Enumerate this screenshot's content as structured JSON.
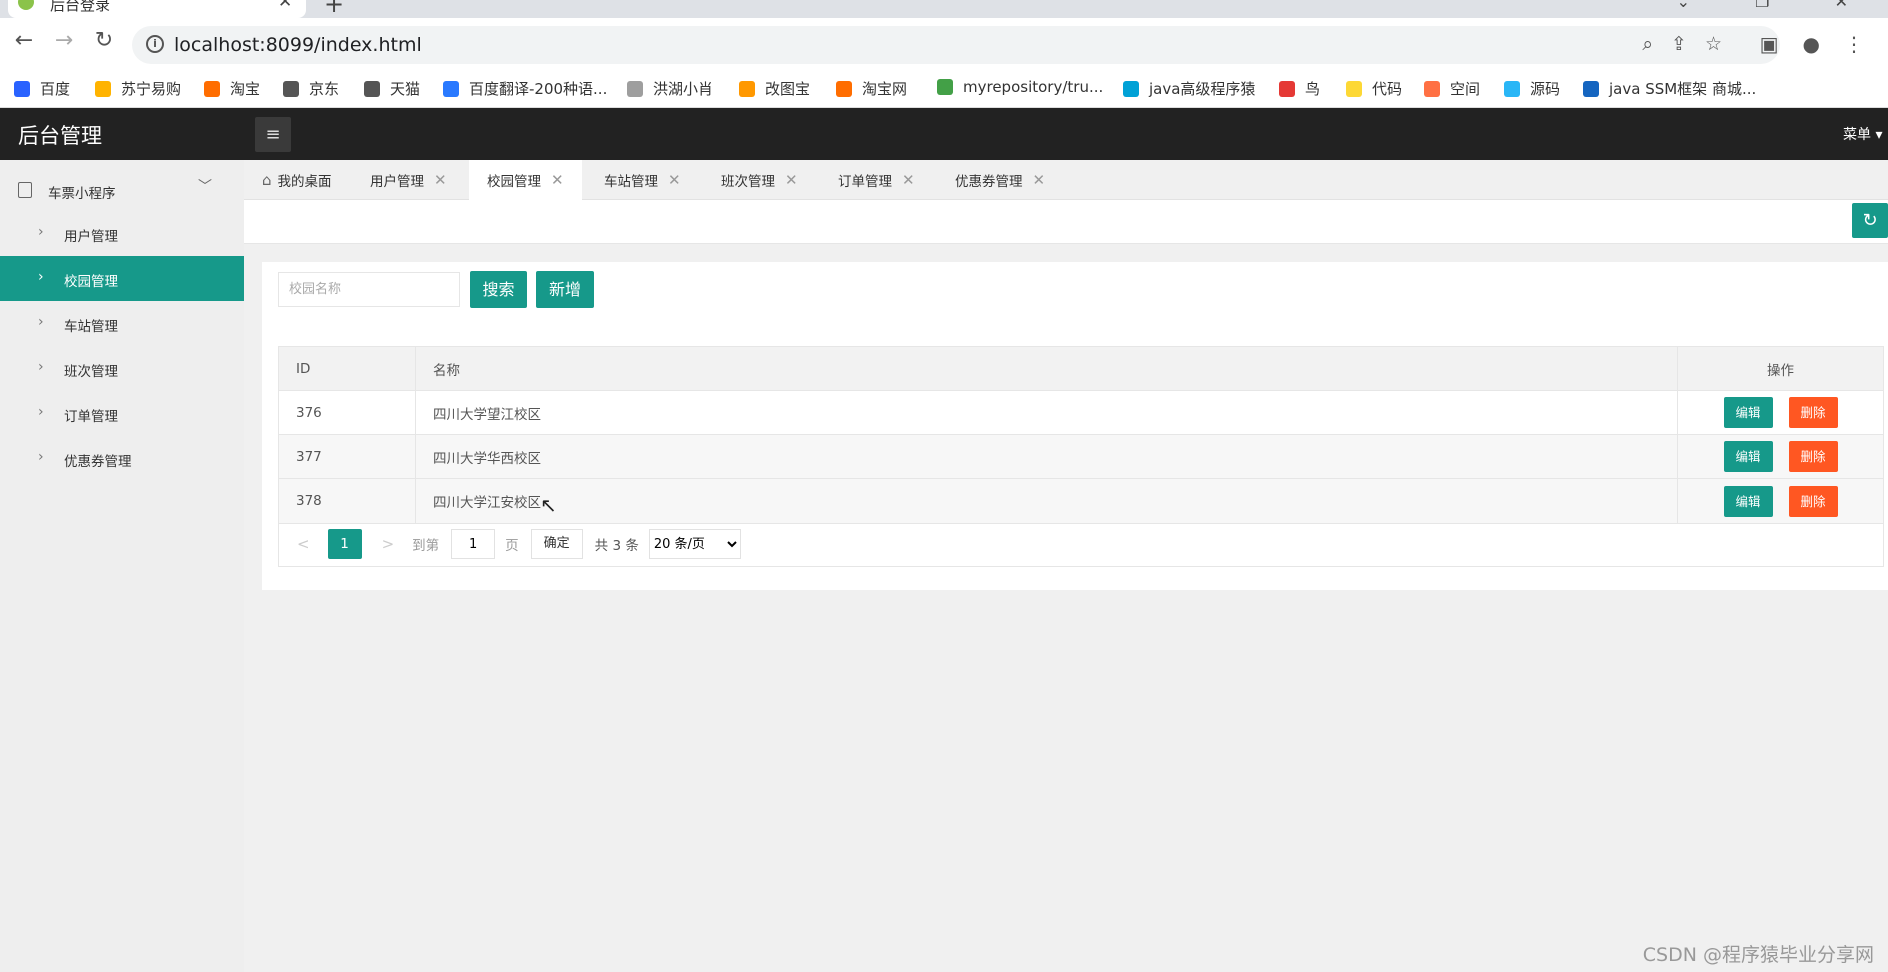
{
  "browser": {
    "tab_title": "后台登录",
    "tab_close": "✕",
    "new_tab": "+",
    "url": "localhost:8099/index.html",
    "bookmarks": [
      {
        "label": "百度",
        "color": "#2962ff"
      },
      {
        "label": "苏宁易购",
        "color": "#ffb300"
      },
      {
        "label": "淘宝",
        "color": "#ff6d00"
      },
      {
        "label": "京东",
        "color": "#555555"
      },
      {
        "label": "天猫",
        "color": "#555555"
      },
      {
        "label": "百度翻译-200种语...",
        "color": "#2979ff"
      },
      {
        "label": "洪湖小肖",
        "color": "#9e9e9e"
      },
      {
        "label": "改图宝",
        "color": "#ff9800"
      },
      {
        "label": "淘宝网",
        "color": "#ff6d00"
      },
      {
        "label": "myrepository/tru...",
        "color": "#43a047"
      },
      {
        "label": "java高级程序猿",
        "color": "#00a1d6"
      },
      {
        "label": "鸟",
        "color": "#e53935"
      },
      {
        "label": "代码",
        "color": "#fdd835"
      },
      {
        "label": "空间",
        "color": "#ff7043"
      },
      {
        "label": "源码",
        "color": "#29b6f6"
      },
      {
        "label": "java SSM框架 商城...",
        "color": "#1565c0"
      }
    ]
  },
  "header": {
    "app_title": "后台管理",
    "menu_label": "菜单 ▾",
    "menu_toggle": "≡"
  },
  "sidebar": {
    "group_label": "车票小程序",
    "group_chev": "﹀",
    "items": [
      {
        "label": "用户管理"
      },
      {
        "label": "校园管理"
      },
      {
        "label": "车站管理"
      },
      {
        "label": "班次管理"
      },
      {
        "label": "订单管理"
      },
      {
        "label": "优惠券管理"
      }
    ]
  },
  "tabs": [
    {
      "label": "我的桌面"
    },
    {
      "label": "用户管理",
      "close": "✕"
    },
    {
      "label": "校园管理",
      "close": "✕"
    },
    {
      "label": "车站管理",
      "close": "✕"
    },
    {
      "label": "班次管理",
      "close": "✕"
    },
    {
      "label": "订单管理",
      "close": "✕"
    },
    {
      "label": "优惠券管理",
      "close": "✕"
    }
  ],
  "search": {
    "placeholder": "校园名称",
    "search_label": "搜索",
    "add_label": "新增"
  },
  "table": {
    "headers": {
      "id": "ID",
      "name": "名称",
      "ops": "操作"
    },
    "rows": [
      {
        "id": "376",
        "name": "四川大学望江校区"
      },
      {
        "id": "377",
        "name": "四川大学华西校区"
      },
      {
        "id": "378",
        "name": "四川大学江安校区"
      }
    ],
    "edit_label": "编辑",
    "delete_label": "删除"
  },
  "pager": {
    "prev": "<",
    "current": "1",
    "next": ">",
    "goto_label": "到第",
    "goto_value": "1",
    "page_label": "页",
    "ok_label": "确定",
    "total": "共 3 条",
    "page_size": "20 条/页"
  },
  "watermark": "CSDN @程序猿毕业分享网",
  "colors": {
    "accent": "#16998a",
    "danger": "#ff5722",
    "header": "#222222"
  }
}
